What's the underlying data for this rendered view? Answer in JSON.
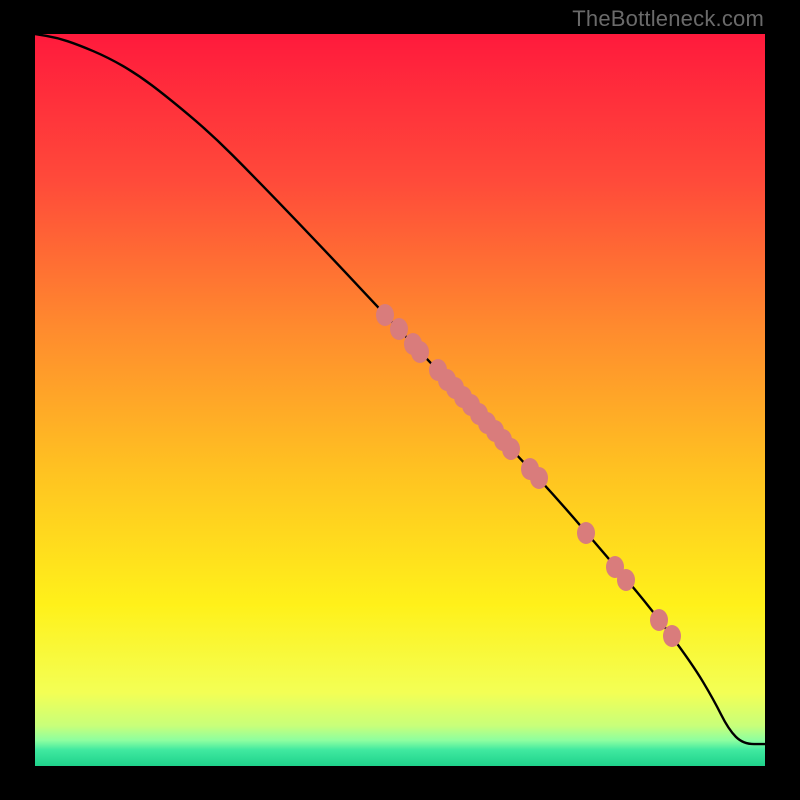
{
  "watermark": "TheBottleneck.com",
  "colors": {
    "frame": "#000000",
    "curve": "#000000",
    "dot": "#d97c7c",
    "watermark": "#6a6a6a",
    "gradient_stops": [
      {
        "offset": 0.0,
        "color": "#ff1a3c"
      },
      {
        "offset": 0.2,
        "color": "#ff4a3a"
      },
      {
        "offset": 0.4,
        "color": "#ff8a2e"
      },
      {
        "offset": 0.6,
        "color": "#ffc321"
      },
      {
        "offset": 0.78,
        "color": "#fff11a"
      },
      {
        "offset": 0.9,
        "color": "#f3ff55"
      },
      {
        "offset": 0.945,
        "color": "#c8ff7a"
      },
      {
        "offset": 0.965,
        "color": "#8dffa0"
      },
      {
        "offset": 0.978,
        "color": "#40e9a0"
      },
      {
        "offset": 1.0,
        "color": "#1fd28b"
      }
    ]
  },
  "chart_data": {
    "type": "line",
    "title": "",
    "xlabel": "",
    "ylabel": "",
    "xlim": [
      0,
      100
    ],
    "ylim": [
      0,
      100
    ],
    "grid": false,
    "legend": false,
    "series": [
      {
        "name": "curve",
        "x": [
          0,
          3,
          6,
          10,
          14,
          18,
          24,
          30,
          36,
          42,
          48,
          54,
          60,
          66,
          72,
          78,
          84,
          90,
          93,
          95,
          97,
          100
        ],
        "y": [
          100,
          99.5,
          98.5,
          96.8,
          94.5,
          91.5,
          86.5,
          80.5,
          74.3,
          68.0,
          61.6,
          55.3,
          48.9,
          42.5,
          36.0,
          29.0,
          22.0,
          14.0,
          9.0,
          5.0,
          3.0,
          3.0
        ]
      }
    ],
    "points": [
      {
        "x": 48.0,
        "y": 61.6
      },
      {
        "x": 49.8,
        "y": 59.7
      },
      {
        "x": 51.8,
        "y": 57.7
      },
      {
        "x": 52.8,
        "y": 56.6
      },
      {
        "x": 55.2,
        "y": 54.1
      },
      {
        "x": 56.4,
        "y": 52.8
      },
      {
        "x": 57.5,
        "y": 51.6
      },
      {
        "x": 58.6,
        "y": 50.4
      },
      {
        "x": 59.7,
        "y": 49.3
      },
      {
        "x": 60.8,
        "y": 48.1
      },
      {
        "x": 61.9,
        "y": 46.9
      },
      {
        "x": 63.0,
        "y": 45.7
      },
      {
        "x": 64.1,
        "y": 44.5
      },
      {
        "x": 65.2,
        "y": 43.3
      },
      {
        "x": 67.8,
        "y": 40.6
      },
      {
        "x": 69.0,
        "y": 39.3
      },
      {
        "x": 75.5,
        "y": 31.8
      },
      {
        "x": 79.5,
        "y": 27.2
      },
      {
        "x": 81.0,
        "y": 25.4
      },
      {
        "x": 85.5,
        "y": 20.0
      },
      {
        "x": 87.3,
        "y": 17.7
      }
    ]
  }
}
